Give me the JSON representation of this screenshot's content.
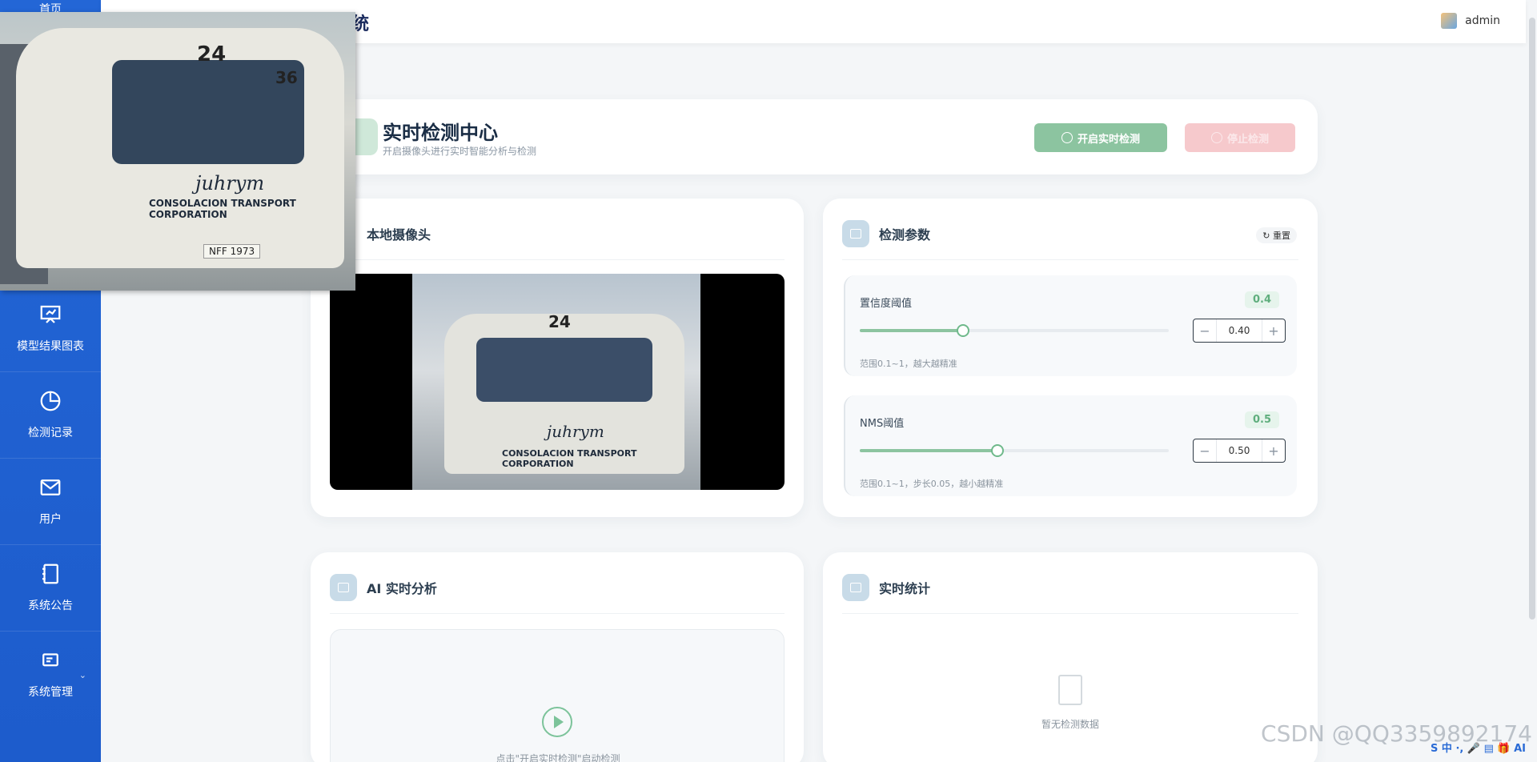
{
  "header": {
    "title_fragment": "统",
    "user": "admin"
  },
  "sidebar": {
    "top_label": "首页",
    "items": [
      {
        "label": "模型结果图表",
        "icon": "presentation-chart-icon"
      },
      {
        "label": "检测记录",
        "icon": "pie-chart-icon"
      },
      {
        "label": "用户",
        "icon": "mail-icon"
      },
      {
        "label": "系统公告",
        "icon": "notebook-icon"
      },
      {
        "label": "系统管理",
        "icon": "settings-panel-icon"
      }
    ]
  },
  "hero": {
    "title": "实时检测中心",
    "subtitle": "开启摄像头进行实时智能分析与检测",
    "start_label": "开启实时检测",
    "stop_label": "停止检测"
  },
  "camera": {
    "title": "本地摄像头",
    "bus_number": "24",
    "brand": "juhrym",
    "corp": "CONSOLACION TRANSPORT CORPORATION"
  },
  "params": {
    "title": "检测参数",
    "reset_label": "重置",
    "confidence": {
      "label": "置信度阈值",
      "value_badge": "0.4",
      "value": 0.4,
      "stepper_value": "0.40",
      "hint": "范围0.1~1，越大越精准",
      "minus": "−",
      "plus": "+"
    },
    "nms": {
      "label": "NMS阈值",
      "value_badge": "0.5",
      "value": 0.5,
      "stepper_value": "0.50",
      "hint": "范围0.1~1，步长0.05，越小越精准",
      "minus": "−",
      "plus": "+"
    }
  },
  "ai": {
    "title": "AI 实时分析",
    "hint": "点击\"开启实时检测\"启动检测"
  },
  "stats": {
    "title": "实时统计",
    "empty": "暂无检测数据"
  },
  "pip": {
    "bus_number": "24",
    "route": "36",
    "brand": "juhrym",
    "corp": "CONSOLACION TRANSPORT CORPORATION",
    "plate": "NFF 1973"
  },
  "watermark": "CSDN @QQ3359892174",
  "tray": "S 中 ·, 🎤 ▤ 🎁 AI"
}
